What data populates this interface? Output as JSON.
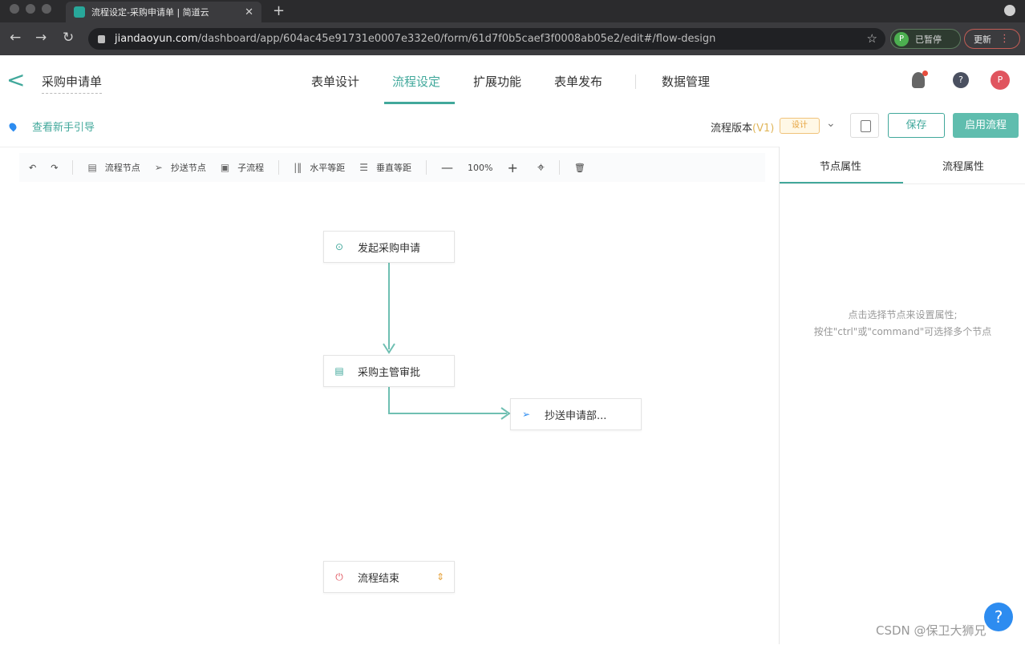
{
  "browser": {
    "tab_title": "流程设定-采购申请单 | 简道云",
    "url_domain": "jiandaoyun.com",
    "url_path": "/dashboard/app/604ac45e91731e0007e332e0/form/61d7f0b5caef3f0008ab05e2/edit#/flow-design",
    "profile_initial": "P",
    "profile_status": "已暂停",
    "update_label": "更新"
  },
  "header": {
    "form_name": "采购申请单",
    "tabs": [
      {
        "label": "表单设计"
      },
      {
        "label": "流程设定"
      },
      {
        "label": "扩展功能"
      },
      {
        "label": "表单发布"
      },
      {
        "label": "数据管理"
      }
    ],
    "user_initial": "P"
  },
  "subbar": {
    "guide_link": "查看新手引导",
    "version_label": "流程版本",
    "version_value": "(V1)",
    "version_badge": "设计",
    "save_label": "保存",
    "enable_label": "启用流程"
  },
  "toolbar": {
    "flow_node": "流程节点",
    "cc_node": "抄送节点",
    "subflow": "子流程",
    "h_spacing": "水平等距",
    "v_spacing": "垂直等距",
    "zoom": "100%"
  },
  "flow": {
    "nodes": [
      {
        "label": "发起采购申请",
        "icon": "play-icon"
      },
      {
        "label": "采购主管审批",
        "icon": "form-icon"
      },
      {
        "label": "抄送申请部...",
        "icon": "send-icon"
      },
      {
        "label": "流程结束",
        "icon": "power-icon"
      }
    ]
  },
  "panel": {
    "tabs": [
      "节点属性",
      "流程属性"
    ],
    "hint_line1": "点击选择节点来设置属性;",
    "hint_line2": "按住\"ctrl\"或\"command\"可选择多个节点"
  },
  "help_label": "?",
  "watermark": "CSDN @保卫大狮兄",
  "colors": {
    "accent": "#41a89b",
    "warning": "#e6a23c",
    "link": "#2d8cf0"
  }
}
